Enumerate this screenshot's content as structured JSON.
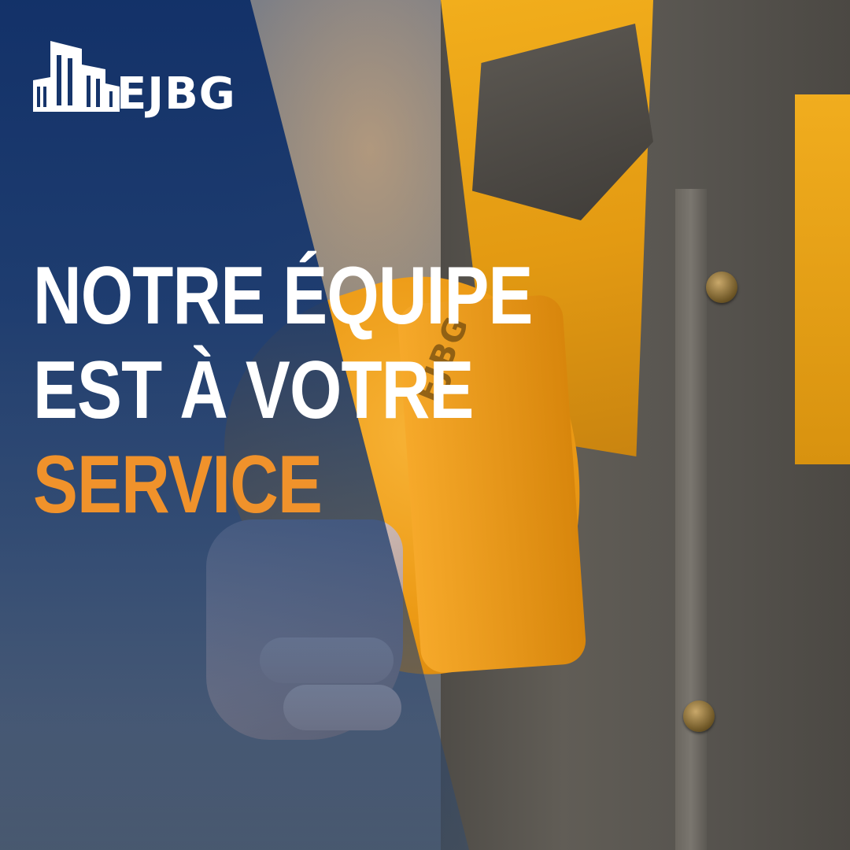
{
  "brand": {
    "name": "EJBG",
    "helmet_print": "EJBG",
    "colors": {
      "navy": "#113068",
      "accent_orange": "#f0922b",
      "text_white": "#ffffff"
    }
  },
  "headline": {
    "line1": "NOTRE ÉQUIPE",
    "line2": "EST À VOTRE",
    "line3": "SERVICE"
  },
  "icons": [
    "building-logo-icon"
  ]
}
